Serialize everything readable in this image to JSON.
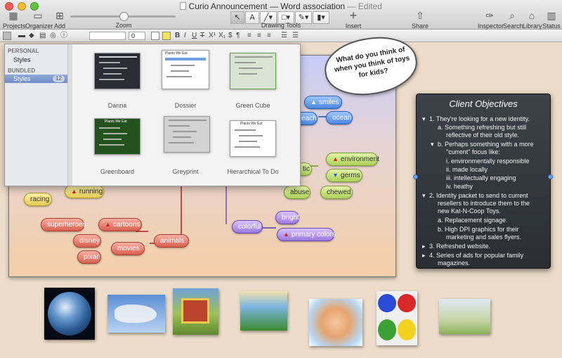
{
  "window": {
    "title": "Curio Announcement — Word association",
    "edited": "— Edited"
  },
  "toolbar": {
    "projects": "Projects",
    "organizer": "Organizer",
    "add": "Add",
    "zoom": "Zoom",
    "drawing_tools": "Drawing Tools",
    "insert": "Insert",
    "share": "Share",
    "inspector": "Inspector",
    "search": "Search",
    "library": "Library",
    "status": "Status"
  },
  "format_bar": {
    "font_size": "0",
    "bold": "B",
    "italic": "I",
    "underline": "U",
    "strike": "T",
    "superscript": "X¹",
    "subscript": "X₁",
    "dollar": "$",
    "pilcrow": "¶"
  },
  "style_popover": {
    "personal_header": "PERSONAL",
    "personal_item": "Styles",
    "bundled_header": "BUNDLED",
    "bundled_item": "Styles",
    "bundled_count": "12",
    "thumbnails": [
      {
        "name": "Danna",
        "color": "#2a2d33"
      },
      {
        "name": "Dossier",
        "color": "#ffffff"
      },
      {
        "name": "Green Cube",
        "color": "#d9e5d2"
      },
      {
        "name": "Greenboard",
        "color": "#23521f"
      },
      {
        "name": "Greyprint",
        "color": "#d2d2d2"
      },
      {
        "name": "Hierarchical To Do",
        "color": "#ffffff"
      }
    ]
  },
  "thumb_text": {
    "plants_we_eat": "Plants We Eat"
  },
  "mindmap": {
    "nodes": {
      "smiles": "smiles",
      "ocean": "ocean",
      "beach": "each",
      "environment": "environment",
      "germs": "germs",
      "tic": "tic",
      "abuse": "abuse",
      "chewed": "chewed",
      "running": "running",
      "racing": "racing",
      "superheroes": "superheroes",
      "cartoons": "cartoons",
      "disney": "disney",
      "pixar": "pixar",
      "movies": "movies",
      "animals": "animals",
      "colorful": "colorful",
      "bright": "bright",
      "primary_colors": "primary colors"
    }
  },
  "bubble": {
    "text": "What do you think of when you think of toys for kids?"
  },
  "objectives": {
    "title": "Client Objectives",
    "lines": [
      "1.  They're looking for a new identity.",
      "a.  Something refreshing but still",
      "reflective of their old style.",
      "b.  Perhaps something with a more",
      "\"current\" focus like:",
      "i.   environmentally responsible",
      "ii.  made locally",
      "iii.  intellectually engaging",
      "iv.  heathy",
      "2.  Identity packet to send to current",
      "resellers to introduce them to the",
      "new Kat-N-Coop Toys.",
      "a.  Replacement signage.",
      "b.  High DPI graphics for their",
      "marketing and sales flyers.",
      "3.  Refreshed website.",
      "4.  Series of ads for popular family",
      "magazines."
    ]
  },
  "colors": {
    "accent": "#4a87e4",
    "selection": "#6f8cc8"
  }
}
